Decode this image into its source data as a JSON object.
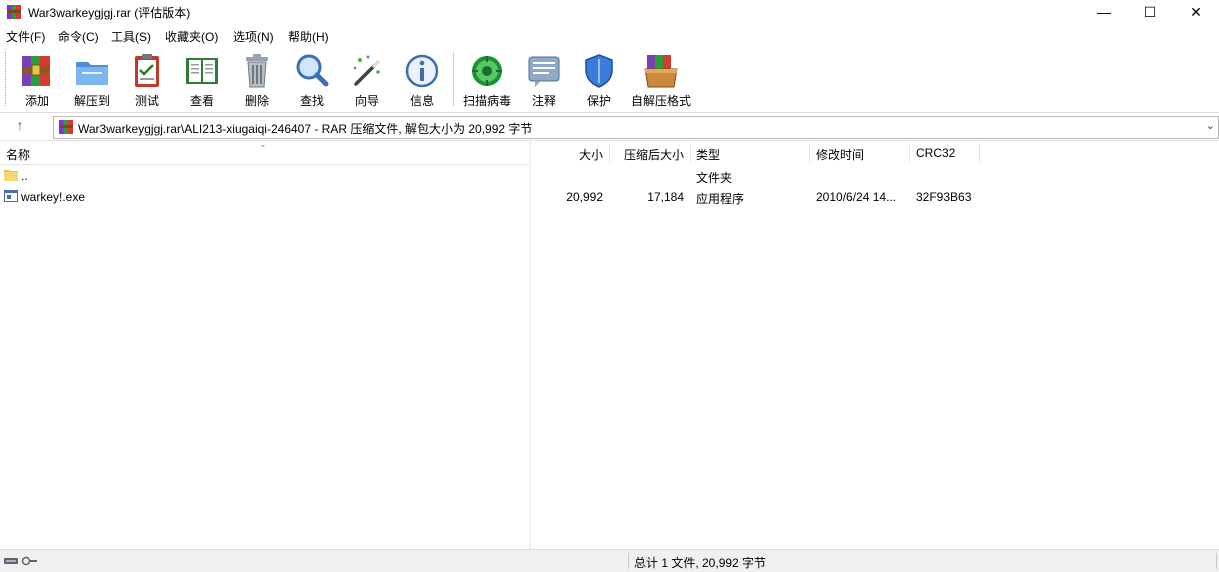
{
  "window": {
    "title": "War3warkeygjgj.rar (评估版本)",
    "minimize_glyph": "—",
    "maximize_glyph": "☐",
    "close_glyph": "✕"
  },
  "menu": [
    "文件(F)",
    "命令(C)",
    "工具(S)",
    "收藏夹(O)",
    "选项(N)",
    "帮助(H)"
  ],
  "toolbar": {
    "buttons": [
      {
        "label": "添加",
        "icon": "add-archive-icon"
      },
      {
        "label": "解压到",
        "icon": "extract-folder-icon"
      },
      {
        "label": "测试",
        "icon": "test-clipboard-icon"
      },
      {
        "label": "查看",
        "icon": "view-book-icon"
      },
      {
        "label": "删除",
        "icon": "trash-icon"
      },
      {
        "label": "查找",
        "icon": "magnifier-icon"
      },
      {
        "label": "向导",
        "icon": "magic-wand-icon"
      },
      {
        "label": "信息",
        "icon": "info-icon"
      },
      {
        "label": "扫描病毒",
        "icon": "virus-scan-icon"
      },
      {
        "label": "注释",
        "icon": "comment-icon"
      },
      {
        "label": "保护",
        "icon": "shield-icon"
      },
      {
        "label": "自解压格式",
        "icon": "sfx-box-icon"
      }
    ]
  },
  "address": {
    "path": "War3warkeygjgj.rar\\ALI213-xiugaiqi-246407 - RAR 压缩文件, 解包大小为 20,992 字节"
  },
  "left_pane": {
    "header": "名称",
    "items": [
      {
        "name": "..",
        "icon": "folder-icon"
      },
      {
        "name": "warkey!.exe",
        "icon": "exe-file-icon"
      }
    ]
  },
  "columns": {
    "size": "大小",
    "packed": "压缩后大小",
    "type": "类型",
    "modified": "修改时间",
    "crc": "CRC32"
  },
  "rows": [
    {
      "size": "",
      "packed": "",
      "type": "文件夹",
      "modified": "",
      "crc": ""
    },
    {
      "size": "20,992",
      "packed": "17,184",
      "type": "应用程序",
      "modified": "2010/6/24 14...",
      "crc": "32F93B63"
    }
  ],
  "status": {
    "text": "总计 1 文件, 20,992 字节"
  }
}
